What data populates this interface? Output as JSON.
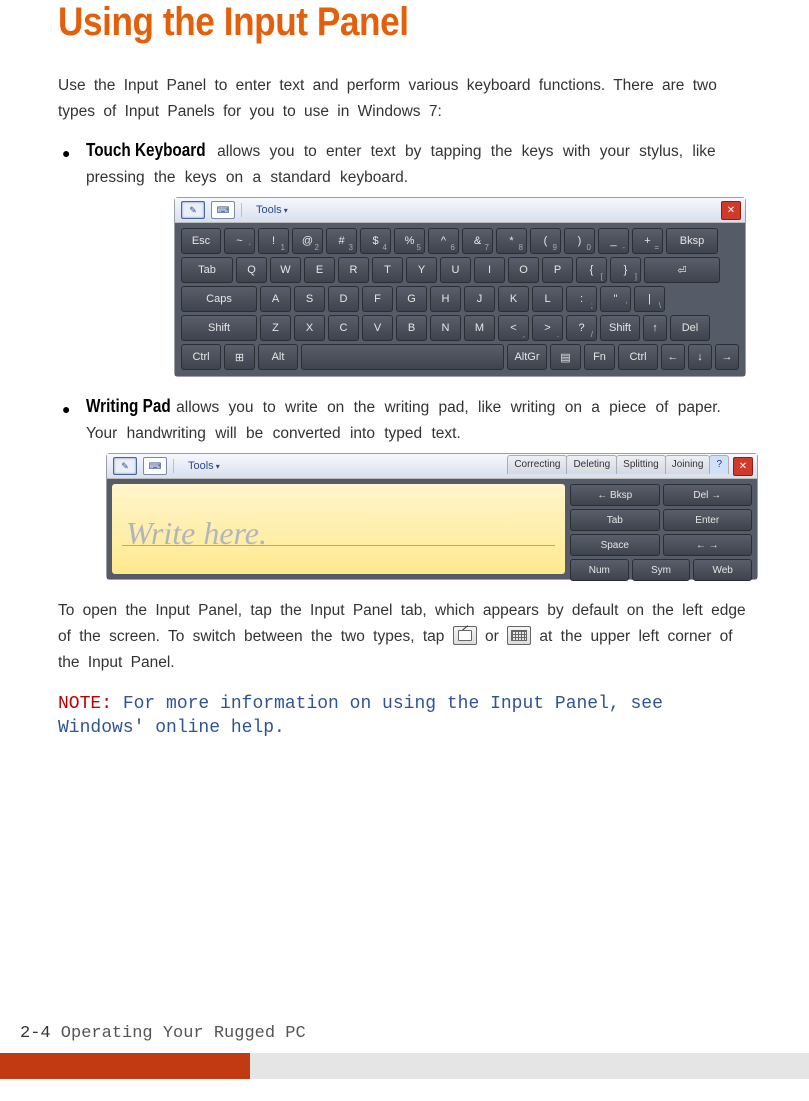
{
  "title": "Using the Input Panel",
  "intro": "Use the Input Panel to enter text and perform various keyboard functions. There are two types of Input Panels for you to use in Windows 7:",
  "features": [
    {
      "name": "Touch Keyboard",
      "desc": " allows you to enter text by tapping the keys with your stylus, like pressing the keys on a standard keyboard."
    },
    {
      "name": "Writing Pad",
      "desc": " allows you to write on the writing pad, like writing on a piece of paper. Your handwriting will be converted into typed text."
    }
  ],
  "keyboard_toolbar": {
    "tools_label": "Tools"
  },
  "keyboard": {
    "row1": [
      {
        "l": "Esc",
        "w": "k-md"
      },
      {
        "l": "~",
        "s": "`",
        "w": "k-sm"
      },
      {
        "l": "!",
        "s": "1",
        "w": "k-sm"
      },
      {
        "l": "@",
        "s": "2",
        "w": "k-sm"
      },
      {
        "l": "#",
        "s": "3",
        "w": "k-sm"
      },
      {
        "l": "$",
        "s": "4",
        "w": "k-sm"
      },
      {
        "l": "%",
        "s": "5",
        "w": "k-sm"
      },
      {
        "l": "^",
        "s": "6",
        "w": "k-sm"
      },
      {
        "l": "&",
        "s": "7",
        "w": "k-sm"
      },
      {
        "l": "*",
        "s": "8",
        "w": "k-sm"
      },
      {
        "l": "(",
        "s": "9",
        "w": "k-sm"
      },
      {
        "l": ")",
        "s": "0",
        "w": "k-sm"
      },
      {
        "l": "_",
        "s": "-",
        "w": "k-sm"
      },
      {
        "l": "+",
        "s": "=",
        "w": "k-sm"
      },
      {
        "l": "Bksp",
        "w": "k-lg"
      }
    ],
    "row2": [
      {
        "l": "Tab",
        "w": "k-lg"
      },
      {
        "l": "Q",
        "w": "k-sm"
      },
      {
        "l": "W",
        "w": "k-sm"
      },
      {
        "l": "E",
        "w": "k-sm"
      },
      {
        "l": "R",
        "w": "k-sm"
      },
      {
        "l": "T",
        "w": "k-sm"
      },
      {
        "l": "Y",
        "w": "k-sm"
      },
      {
        "l": "U",
        "w": "k-sm"
      },
      {
        "l": "I",
        "w": "k-sm"
      },
      {
        "l": "O",
        "w": "k-sm"
      },
      {
        "l": "P",
        "w": "k-sm"
      },
      {
        "l": "{",
        "s": "[",
        "w": "k-sm"
      },
      {
        "l": "}",
        "s": "]",
        "w": "k-sm"
      },
      {
        "l": "⏎",
        "w": "k-xl"
      }
    ],
    "row3": [
      {
        "l": "Caps",
        "w": "k-xl"
      },
      {
        "l": "A",
        "w": "k-sm"
      },
      {
        "l": "S",
        "w": "k-sm"
      },
      {
        "l": "D",
        "w": "k-sm"
      },
      {
        "l": "F",
        "w": "k-sm"
      },
      {
        "l": "G",
        "w": "k-sm"
      },
      {
        "l": "H",
        "w": "k-sm"
      },
      {
        "l": "J",
        "w": "k-sm"
      },
      {
        "l": "K",
        "w": "k-sm"
      },
      {
        "l": "L",
        "w": "k-sm"
      },
      {
        "l": ":",
        "s": ";",
        "w": "k-sm"
      },
      {
        "l": "\"",
        "s": "'",
        "w": "k-sm"
      },
      {
        "l": "|",
        "s": "\\",
        "w": "k-sm"
      }
    ],
    "row4": [
      {
        "l": "Shift",
        "w": "k-xl"
      },
      {
        "l": "Z",
        "w": "k-sm"
      },
      {
        "l": "X",
        "w": "k-sm"
      },
      {
        "l": "C",
        "w": "k-sm"
      },
      {
        "l": "V",
        "w": "k-sm"
      },
      {
        "l": "B",
        "w": "k-sm"
      },
      {
        "l": "N",
        "w": "k-sm"
      },
      {
        "l": "M",
        "w": "k-sm"
      },
      {
        "l": "<",
        "s": ",",
        "w": "k-sm"
      },
      {
        "l": ">",
        "s": ".",
        "w": "k-sm"
      },
      {
        "l": "?",
        "s": "/",
        "w": "k-sm"
      },
      {
        "l": "Shift",
        "w": "k-md"
      },
      {
        "l": "↑",
        "w": "k-half"
      },
      {
        "l": "Del",
        "w": "k-md"
      }
    ],
    "row5": [
      {
        "l": "Ctrl",
        "w": "k-md"
      },
      {
        "l": "⊞",
        "w": "k-sm"
      },
      {
        "l": "Alt",
        "w": "k-md"
      },
      {
        "l": " ",
        "w": "k-fill"
      },
      {
        "l": "AltGr",
        "w": "k-md"
      },
      {
        "l": "▤",
        "w": "k-sm"
      },
      {
        "l": "Fn",
        "w": "k-sm"
      },
      {
        "l": "Ctrl",
        "w": "k-md"
      },
      {
        "l": "←",
        "w": "k-half"
      },
      {
        "l": "↓",
        "w": "k-half"
      },
      {
        "l": "→",
        "w": "k-half"
      }
    ]
  },
  "pad": {
    "tools_label": "Tools",
    "tabs": [
      "Correcting",
      "Deleting",
      "Splitting",
      "Joining"
    ],
    "help": "?",
    "placeholder": "Write here.",
    "sidekeys": [
      [
        {
          "l": "← Bksp"
        },
        {
          "l": "Del →"
        }
      ],
      [
        {
          "l": "Tab"
        },
        {
          "l": "Enter"
        }
      ],
      [
        {
          "l": "Space"
        },
        {
          "l": "← →"
        }
      ],
      [
        {
          "l": "Num"
        },
        {
          "l": "Sym"
        },
        {
          "l": "Web"
        }
      ]
    ]
  },
  "open_para_a": "To open the Input Panel, tap the Input Panel tab, which appears by default on the left edge of the screen. To switch between the two types, tap ",
  "open_para_b": " or ",
  "open_para_c": " at the upper left corner of the Input Panel.",
  "note_label": "NOTE:",
  "note_text": " For more information on using the Input Panel, see Windows' online help.",
  "footer_page": "2-4",
  "footer_title": "  Operating Your Rugged PC"
}
